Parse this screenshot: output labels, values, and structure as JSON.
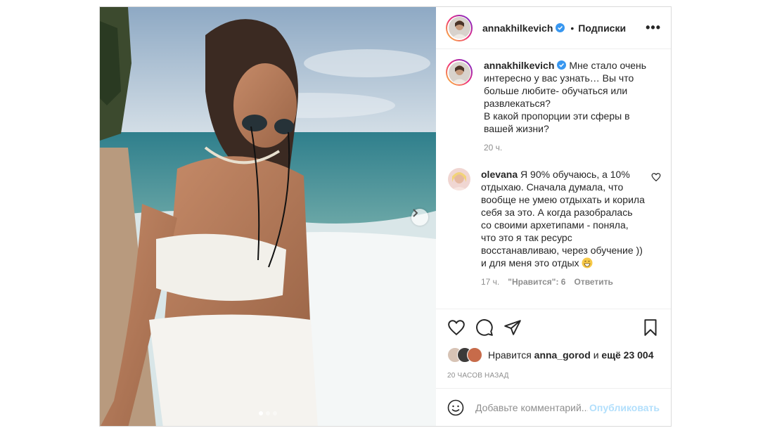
{
  "post": {
    "author": "annakhilkevich",
    "follow_separator": "•",
    "follow_label": "Подписки",
    "more_label": "•••",
    "caption": {
      "username": "annakhilkevich",
      "text": "Мне стало очень интересно у вас узнать… Вы что больше любите- обучаться или развлекаться?\nВ какой пропорции эти сферы в вашей жизни?",
      "time": "20 ч."
    },
    "comments": [
      {
        "username": "olevana",
        "text": "Я 90% обучаюсь, а 10% отдыхаю. Сначала думала, что вообще не умею отдыхать и корила себя за это. А когда разобралась со своими архетипами - поняла, что это я так ресурс восстанавливаю, через обучение )) и для меня это отдых",
        "time": "17 ч.",
        "likes": "\"Нравится\": 6",
        "reply": "Ответить"
      }
    ],
    "likes": {
      "prefix": "Нравится",
      "user": "anna_gorod",
      "middle": "и",
      "rest": "ещё 23 004"
    },
    "timestamp": "20 ЧАСОВ НАЗАД",
    "comment_input": {
      "placeholder": "Добавьте комментарий...",
      "publish": "Опубликовать"
    },
    "carousel": {
      "slides": 3,
      "active": 0
    }
  },
  "colors": {
    "verified": "#3897f0",
    "publish_disabled": "#b2dffc",
    "muted": "#8e8e8e"
  }
}
